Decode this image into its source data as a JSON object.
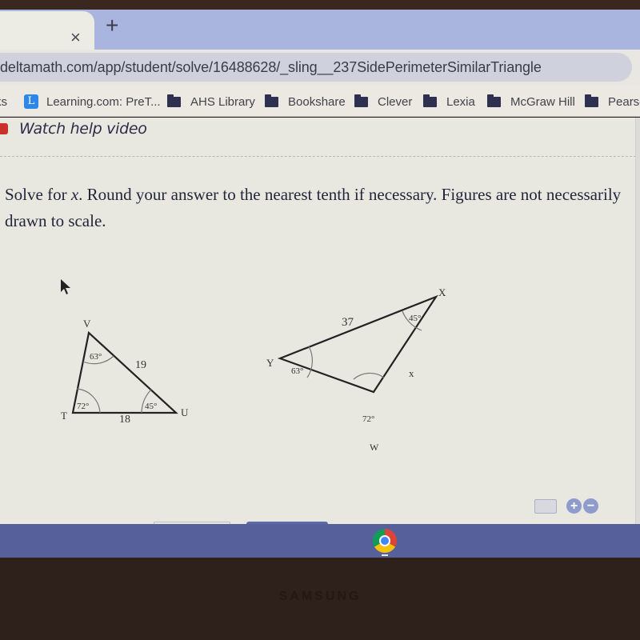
{
  "browser": {
    "tab": {
      "close_icon": "×",
      "new_tab_icon": "+"
    },
    "url": "deltamath.com/app/student/solve/16488628/_sling__237SidePerimeterSimilarTriangle",
    "bookmarks": [
      {
        "label": "ks",
        "icon": "none"
      },
      {
        "label": "Learning.com: PreT...",
        "icon": "L"
      },
      {
        "label": "AHS Library",
        "icon": "folder-icon"
      },
      {
        "label": "Bookshare",
        "icon": "folder-icon"
      },
      {
        "label": "Clever",
        "icon": "folder-icon"
      },
      {
        "label": "Lexia",
        "icon": "folder-icon"
      },
      {
        "label": "McGraw Hill",
        "icon": "folder-icon"
      },
      {
        "label": "Pearso",
        "icon": "folder-icon"
      }
    ]
  },
  "page": {
    "help_link": "Watch help video",
    "question": {
      "part1": "Solve for ",
      "variable": "x",
      "part2": ". Round your answer to the nearest tenth if necessary. Figures are not necessarily drawn to scale."
    },
    "triangle1": {
      "vertices": {
        "V": "V",
        "T": "T",
        "U": "U"
      },
      "angles": {
        "V": "63°",
        "T": "72°",
        "U": "45°"
      },
      "sides": {
        "VU": "19",
        "TU": "18"
      }
    },
    "triangle2": {
      "vertices": {
        "X": "X",
        "Y": "Y",
        "W": "W"
      },
      "angles": {
        "X": "45°",
        "Y": "63°",
        "W": "72°"
      },
      "sides": {
        "YX": "37",
        "XW": "x"
      }
    },
    "controls": {
      "zoom_in": "+",
      "zoom_out": "−"
    }
  },
  "device": {
    "brand": "SAMSUNG"
  }
}
